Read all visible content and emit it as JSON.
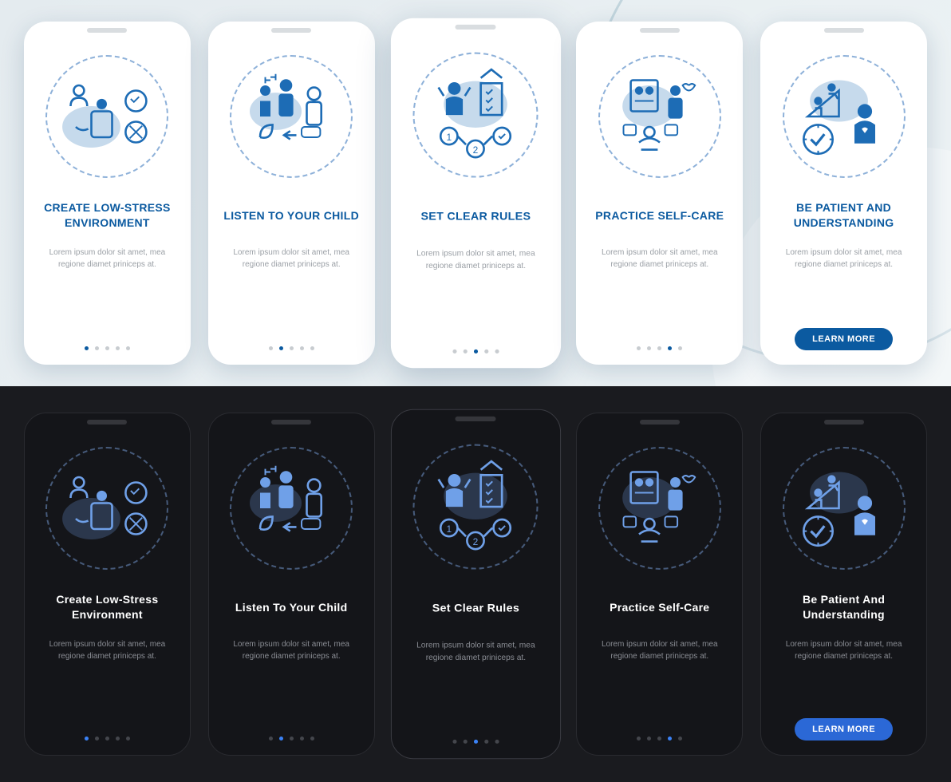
{
  "lorem": "Lorem ipsum dolor sit amet, mea regione diamet priniceps at.",
  "cta": "LEARN MORE",
  "light": {
    "slides": [
      {
        "title": "CREATE LOW-STRESS ENVIRONMENT",
        "icon": "low-stress"
      },
      {
        "title": "LISTEN TO YOUR CHILD",
        "icon": "listen"
      },
      {
        "title": "SET CLEAR RULES",
        "icon": "rules"
      },
      {
        "title": "PRACTICE SELF-CARE",
        "icon": "selfcare"
      },
      {
        "title": "BE PATIENT AND UNDERSTANDING",
        "icon": "patient"
      }
    ]
  },
  "dark": {
    "slides": [
      {
        "title": "Create Low-Stress Environment",
        "icon": "low-stress"
      },
      {
        "title": "Listen To Your Child",
        "icon": "listen"
      },
      {
        "title": "Set Clear Rules",
        "icon": "rules"
      },
      {
        "title": "Practice Self-Care",
        "icon": "selfcare"
      },
      {
        "title": "Be Patient And Understanding",
        "icon": "patient"
      }
    ]
  },
  "colors": {
    "accentLight": "#0b5aa0",
    "accentDark": "#2b68d6",
    "lightBg": "#e4ebef",
    "darkBg": "#1a1b1f"
  }
}
